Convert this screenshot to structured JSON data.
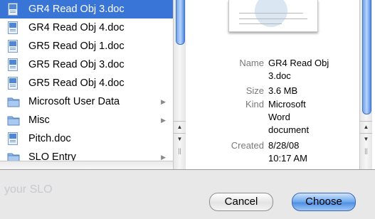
{
  "file_list": [
    {
      "name": "GR4 Read Obj 3.doc",
      "type": "doc",
      "selected": true,
      "folder": false
    },
    {
      "name": "GR4 Read Obj 4.doc",
      "type": "doc",
      "selected": false,
      "folder": false
    },
    {
      "name": "GR5 Read Obj 1.doc",
      "type": "doc",
      "selected": false,
      "folder": false
    },
    {
      "name": "GR5 Read Obj 3.doc",
      "type": "doc",
      "selected": false,
      "folder": false
    },
    {
      "name": "GR5 Read Obj 4.doc",
      "type": "doc",
      "selected": false,
      "folder": false
    },
    {
      "name": "Microsoft User Data",
      "type": "folder",
      "selected": false,
      "folder": true
    },
    {
      "name": "Misc",
      "type": "folder",
      "selected": false,
      "folder": true
    },
    {
      "name": "Pitch.doc",
      "type": "doc",
      "selected": false,
      "folder": false
    },
    {
      "name": "SLO Entry",
      "type": "folder",
      "selected": false,
      "folder": true
    }
  ],
  "preview": {
    "name_key": "Name",
    "name_value_line1": "GR4 Read Obj",
    "name_value_line2": "3.doc",
    "size_key": "Size",
    "size_value": "3.6 MB",
    "kind_key": "Kind",
    "kind_value_line1": "Microsoft",
    "kind_value_line2": "Word",
    "kind_value_line3": "document",
    "created_key": "Created",
    "created_value_line1": "8/28/08",
    "created_value_line2": "10:17 AM"
  },
  "background_text": "your SLO",
  "buttons": {
    "cancel": "Cancel",
    "choose": "Choose"
  },
  "colors": {
    "selection": "#3875d7",
    "default_button": "#5a98e8"
  }
}
